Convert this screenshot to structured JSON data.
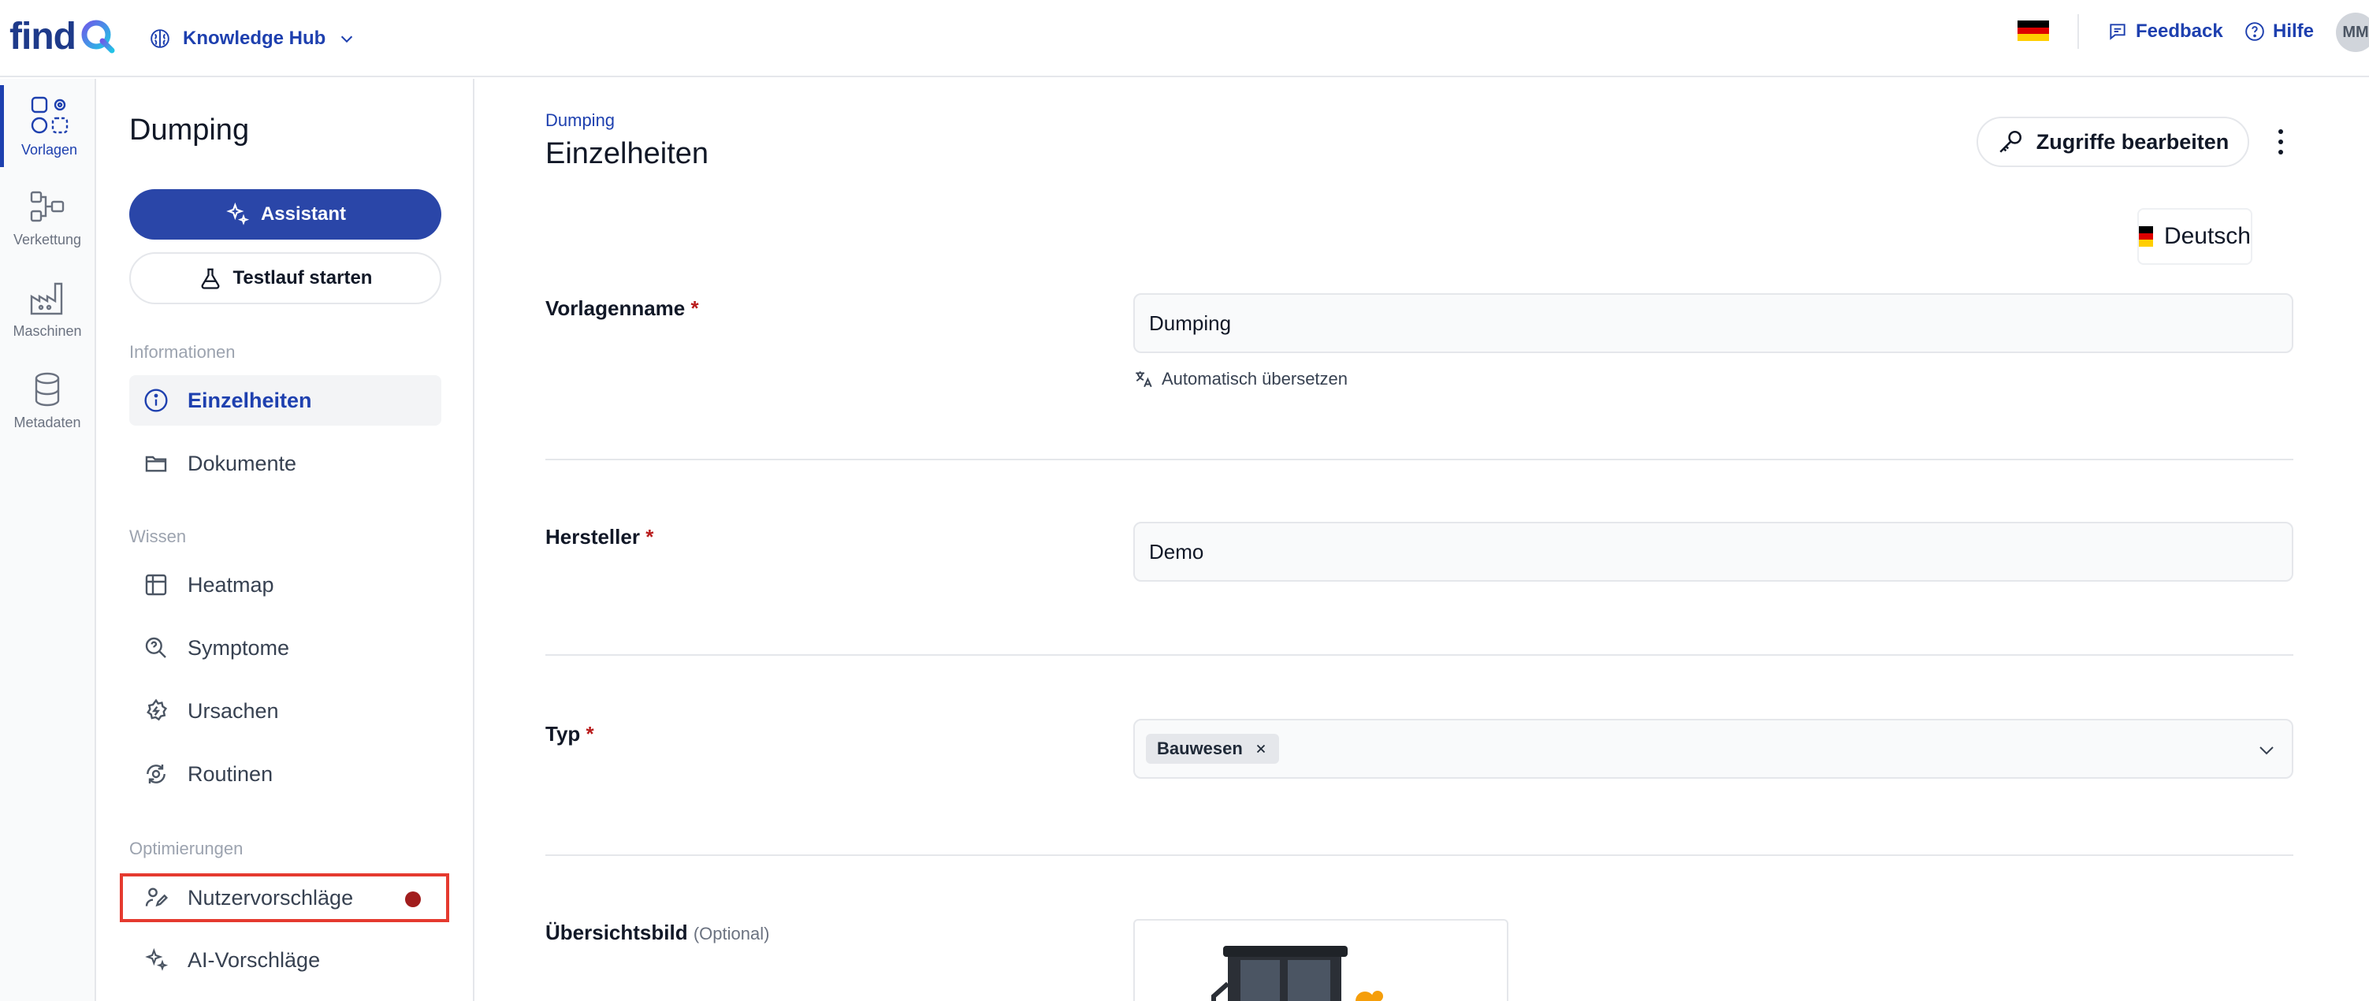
{
  "header": {
    "logo_text": "find",
    "hub_label": "Knowledge Hub",
    "feedback_label": "Feedback",
    "help_label": "Hilfe",
    "avatar_initials": "MM"
  },
  "rail": [
    {
      "label": "Vorlagen",
      "icon": "templates-icon",
      "active": true
    },
    {
      "label": "Verkettung",
      "icon": "chain-icon"
    },
    {
      "label": "Maschinen",
      "icon": "factory-icon"
    },
    {
      "label": "Metadaten",
      "icon": "database-icon"
    }
  ],
  "sidenav": {
    "title": "Dumping",
    "assistant_label": "Assistant",
    "test_run_label": "Testlauf starten",
    "sections": {
      "info": "Informationen",
      "knowledge": "Wissen",
      "optim": "Optimierungen"
    },
    "items": {
      "details": "Einzelheiten",
      "documents": "Dokumente",
      "heatmap": "Heatmap",
      "symptoms": "Symptome",
      "causes": "Ursachen",
      "routines": "Routinen",
      "user_suggestions": "Nutzervorschläge",
      "ai_suggestions": "AI-Vorschläge"
    }
  },
  "main": {
    "breadcrumb": "Dumping",
    "title": "Einzelheiten",
    "access_button": "Zugriffe bearbeiten",
    "language": "Deutsch",
    "fields": {
      "name_label": "Vorlagenname",
      "name_value": "Dumping",
      "auto_translate": "Automatisch übersetzen",
      "manufacturer_label": "Hersteller",
      "manufacturer_value": "Demo",
      "type_label": "Typ",
      "type_chip": "Bauwesen",
      "image_label": "Übersichtsbild",
      "image_optional": "(Optional)",
      "required_mark": "*"
    }
  },
  "colors": {
    "accent": "#1e40af",
    "primary_button": "#2a46a8",
    "required": "#b91c1c",
    "highlight_box": "#e53a2f",
    "notification_dot": "#a11d1d"
  }
}
